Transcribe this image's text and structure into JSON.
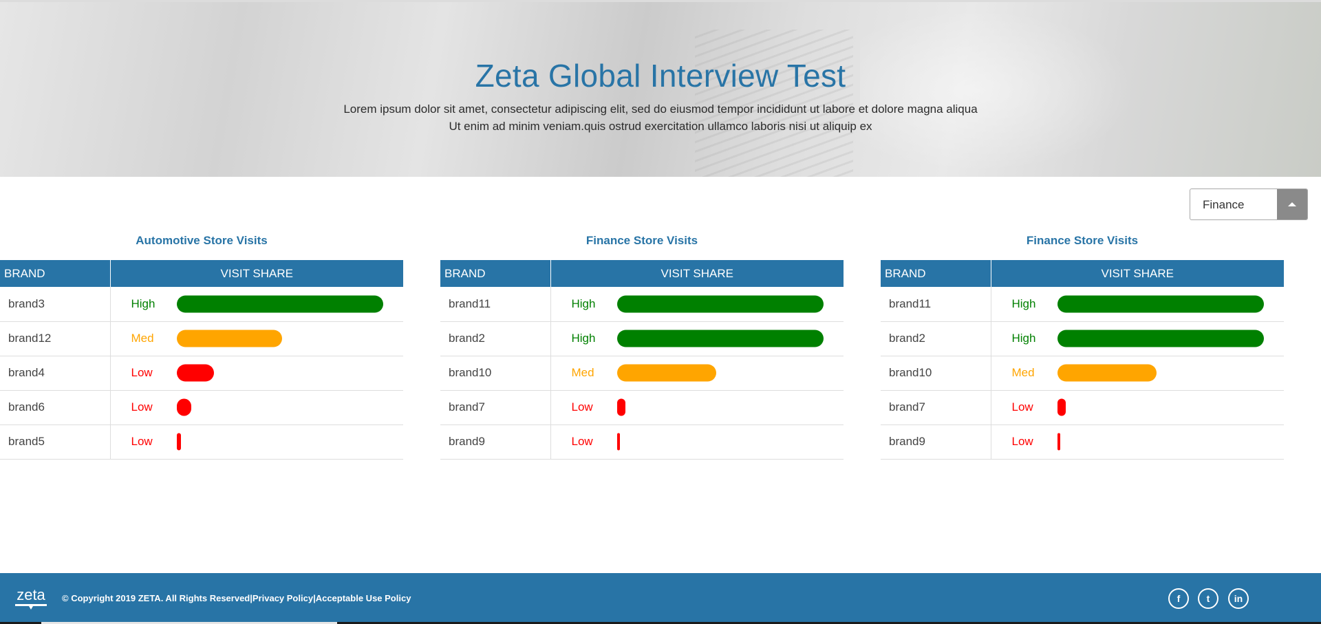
{
  "hero": {
    "title": "Zeta Global Interview Test",
    "subtitle_line1": "Lorem ipsum dolor sit amet, consectetur adipiscing elit, sed do eiusmod tempor incididunt ut labore et dolore magna aliqua",
    "subtitle_line2": "Ut enim ad minim veniam.quis ostrud exercitation ullamco laboris nisi ut aliquip ex"
  },
  "category_select": {
    "value": "Finance"
  },
  "table_headers": {
    "brand": "BRAND",
    "visit_share": "VISIT SHARE"
  },
  "level_colors": {
    "High": "#008000",
    "Med": "#ffa500",
    "Low": "#ff0000"
  },
  "panels": [
    {
      "title": "Automotive Store Visits",
      "rows": [
        {
          "brand": "brand3",
          "level": "High",
          "share": 1.0
        },
        {
          "brand": "brand12",
          "level": "Med",
          "share": 0.51
        },
        {
          "brand": "brand4",
          "level": "Low",
          "share": 0.18
        },
        {
          "brand": "brand6",
          "level": "Low",
          "share": 0.07
        },
        {
          "brand": "brand5",
          "level": "Low",
          "share": 0.02
        }
      ]
    },
    {
      "title": "Finance Store Visits",
      "rows": [
        {
          "brand": "brand11",
          "level": "High",
          "share": 1.0
        },
        {
          "brand": "brand2",
          "level": "High",
          "share": 1.0
        },
        {
          "brand": "brand10",
          "level": "Med",
          "share": 0.48
        },
        {
          "brand": "brand7",
          "level": "Low",
          "share": 0.04
        },
        {
          "brand": "brand9",
          "level": "Low",
          "share": 0.01
        }
      ]
    },
    {
      "title": "Finance Store Visits",
      "rows": [
        {
          "brand": "brand11",
          "level": "High",
          "share": 1.0
        },
        {
          "brand": "brand2",
          "level": "High",
          "share": 1.0
        },
        {
          "brand": "brand10",
          "level": "Med",
          "share": 0.48
        },
        {
          "brand": "brand7",
          "level": "Low",
          "share": 0.04
        },
        {
          "brand": "brand9",
          "level": "Low",
          "share": 0.01
        }
      ]
    }
  ],
  "footer": {
    "logo_text": "zeta",
    "copyright": "© Copyright 2019 ZETA. All Rights Reserved",
    "sep1": "|",
    "privacy": "Privacy Policy",
    "sep2": "|",
    "aup": "Acceptable Use Policy",
    "social": [
      {
        "name": "facebook-icon",
        "glyph": "f"
      },
      {
        "name": "twitter-icon",
        "glyph": "t"
      },
      {
        "name": "linkedin-icon",
        "glyph": "in"
      }
    ]
  }
}
